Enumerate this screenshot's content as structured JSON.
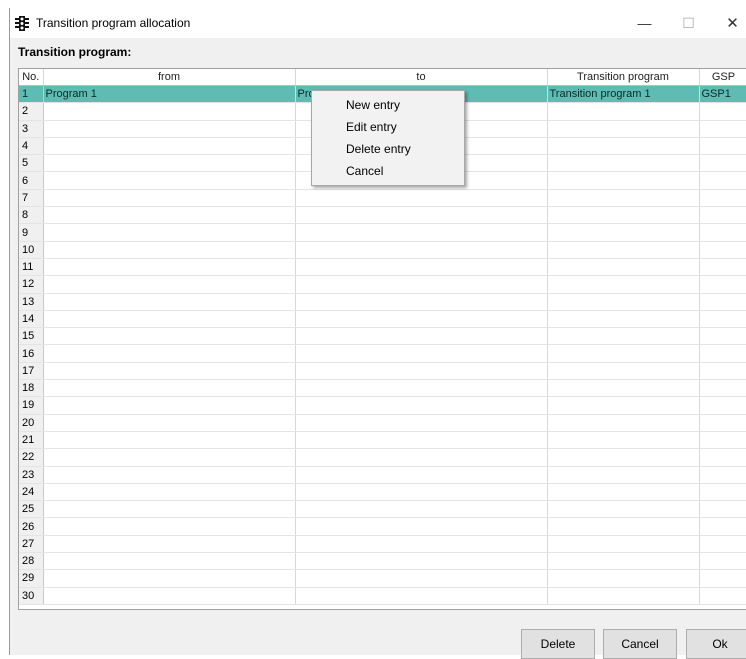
{
  "window": {
    "title": "Transition program allocation",
    "icon": "traffic-light-icon"
  },
  "section_label": "Transition program:",
  "table": {
    "columns": [
      "No.",
      "from",
      "to",
      "Transition program",
      "GSP"
    ],
    "rows": [
      {
        "no": "1",
        "from": "Program 1",
        "to": "Pro",
        "transition": "Transition program 1",
        "gsp": "GSP1"
      },
      {
        "no": "2",
        "from": "",
        "to": "",
        "transition": "",
        "gsp": ""
      },
      {
        "no": "3",
        "from": "",
        "to": "",
        "transition": "",
        "gsp": ""
      },
      {
        "no": "4",
        "from": "",
        "to": "",
        "transition": "",
        "gsp": ""
      },
      {
        "no": "5",
        "from": "",
        "to": "",
        "transition": "",
        "gsp": ""
      },
      {
        "no": "6",
        "from": "",
        "to": "",
        "transition": "",
        "gsp": ""
      },
      {
        "no": "7",
        "from": "",
        "to": "",
        "transition": "",
        "gsp": ""
      },
      {
        "no": "8",
        "from": "",
        "to": "",
        "transition": "",
        "gsp": ""
      },
      {
        "no": "9",
        "from": "",
        "to": "",
        "transition": "",
        "gsp": ""
      },
      {
        "no": "10",
        "from": "",
        "to": "",
        "transition": "",
        "gsp": ""
      },
      {
        "no": "11",
        "from": "",
        "to": "",
        "transition": "",
        "gsp": ""
      },
      {
        "no": "12",
        "from": "",
        "to": "",
        "transition": "",
        "gsp": ""
      },
      {
        "no": "13",
        "from": "",
        "to": "",
        "transition": "",
        "gsp": ""
      },
      {
        "no": "14",
        "from": "",
        "to": "",
        "transition": "",
        "gsp": ""
      },
      {
        "no": "15",
        "from": "",
        "to": "",
        "transition": "",
        "gsp": ""
      },
      {
        "no": "16",
        "from": "",
        "to": "",
        "transition": "",
        "gsp": ""
      },
      {
        "no": "17",
        "from": "",
        "to": "",
        "transition": "",
        "gsp": ""
      },
      {
        "no": "18",
        "from": "",
        "to": "",
        "transition": "",
        "gsp": ""
      },
      {
        "no": "19",
        "from": "",
        "to": "",
        "transition": "",
        "gsp": ""
      },
      {
        "no": "20",
        "from": "",
        "to": "",
        "transition": "",
        "gsp": ""
      },
      {
        "no": "21",
        "from": "",
        "to": "",
        "transition": "",
        "gsp": ""
      },
      {
        "no": "22",
        "from": "",
        "to": "",
        "transition": "",
        "gsp": ""
      },
      {
        "no": "23",
        "from": "",
        "to": "",
        "transition": "",
        "gsp": ""
      },
      {
        "no": "24",
        "from": "",
        "to": "",
        "transition": "",
        "gsp": ""
      },
      {
        "no": "25",
        "from": "",
        "to": "",
        "transition": "",
        "gsp": ""
      },
      {
        "no": "26",
        "from": "",
        "to": "",
        "transition": "",
        "gsp": ""
      },
      {
        "no": "27",
        "from": "",
        "to": "",
        "transition": "",
        "gsp": ""
      },
      {
        "no": "28",
        "from": "",
        "to": "",
        "transition": "",
        "gsp": ""
      },
      {
        "no": "29",
        "from": "",
        "to": "",
        "transition": "",
        "gsp": ""
      },
      {
        "no": "30",
        "from": "",
        "to": "",
        "transition": "",
        "gsp": ""
      }
    ],
    "selected_row": 0
  },
  "context_menu": {
    "items": [
      "New entry",
      "Edit entry",
      "Delete entry",
      "Cancel"
    ]
  },
  "buttons": {
    "delete": "Delete",
    "cancel": "Cancel",
    "ok": "Ok"
  },
  "colors": {
    "selection": "#5dbdb3"
  }
}
